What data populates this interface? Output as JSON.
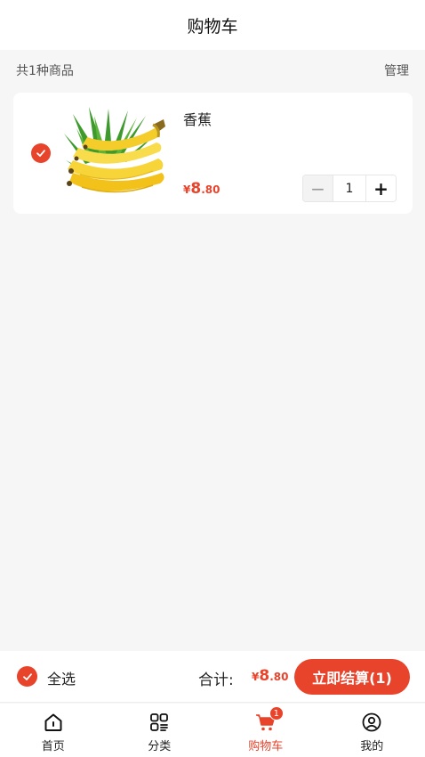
{
  "header": {
    "title": "购物车"
  },
  "subbar": {
    "count_text": "共1种商品",
    "manage_label": "管理"
  },
  "cart": {
    "items": [
      {
        "name": "香蕉",
        "price_symbol": "¥",
        "price_int": "8",
        "price_dec": ".80",
        "quantity": "1",
        "checked": true
      }
    ]
  },
  "stepper": {
    "minus": "−",
    "plus": "+"
  },
  "checkout": {
    "select_all_label": "全选",
    "total_label": "合计:",
    "total_symbol": "¥",
    "total_int": "8",
    "total_dec": ".80",
    "button_label": "立即结算(1)"
  },
  "tabbar": {
    "tabs": [
      {
        "label": "首页",
        "icon": "home-icon"
      },
      {
        "label": "分类",
        "icon": "category-icon"
      },
      {
        "label": "购物车",
        "icon": "cart-icon",
        "badge": "1",
        "active": true
      },
      {
        "label": "我的",
        "icon": "profile-icon"
      }
    ]
  },
  "colors": {
    "accent": "#e8432b",
    "background": "#f6f6f6"
  }
}
